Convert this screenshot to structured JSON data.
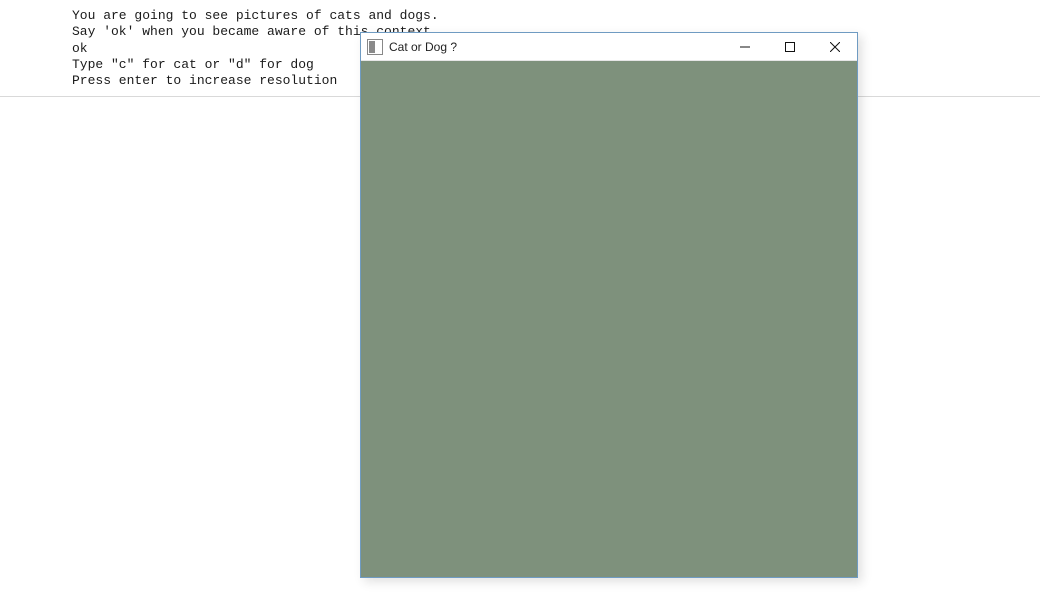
{
  "console": {
    "lines": [
      "You are going to see pictures of cats and dogs.",
      "Say 'ok' when you became aware of this context",
      "ok",
      "Type \"c\" for cat or \"d\" for dog",
      "Press enter to increase resolution"
    ]
  },
  "window": {
    "title": "Cat or Dog ?",
    "content_color": "#7e917c"
  }
}
